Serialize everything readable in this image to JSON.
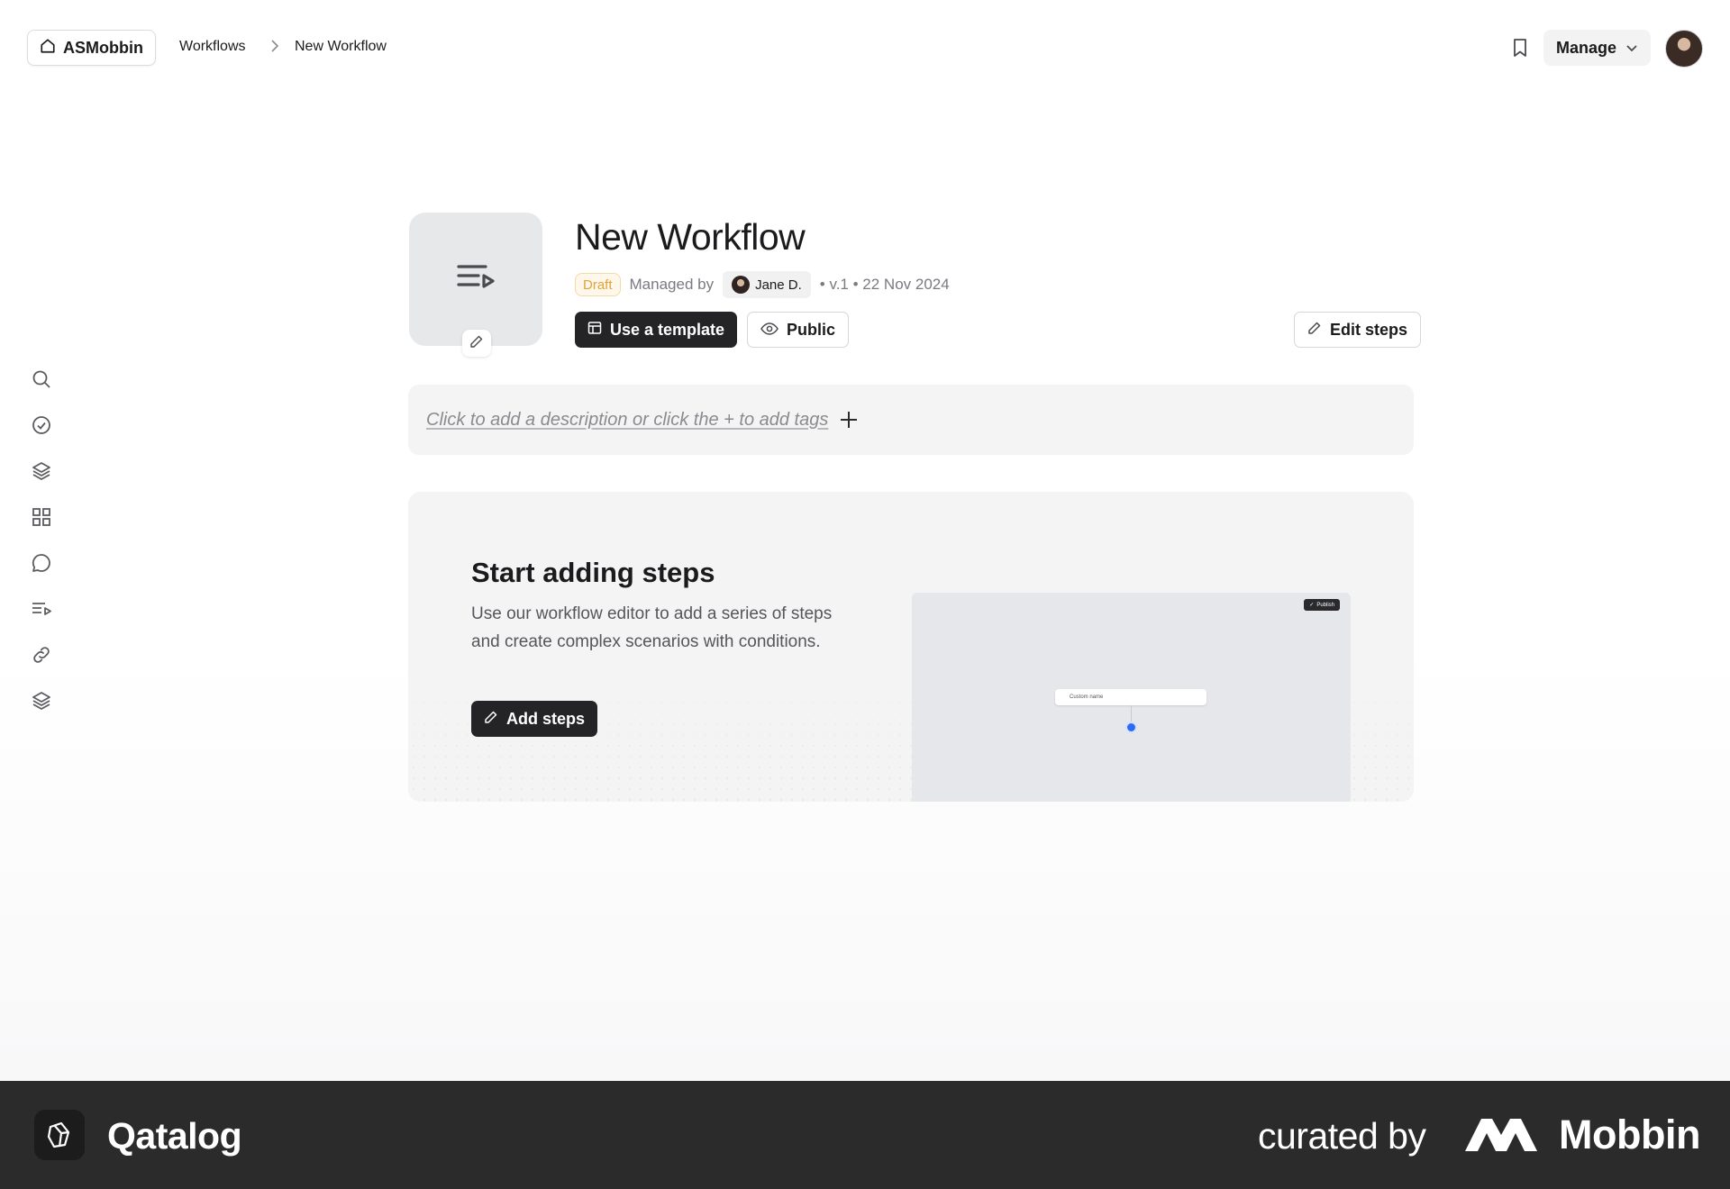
{
  "topbar": {
    "workspace_label": "ASMobbin",
    "breadcrumb": [
      "Workflows",
      "New Workflow"
    ],
    "manage_label": "Manage"
  },
  "workflow": {
    "title": "New Workflow",
    "status": "Draft",
    "managed_by_label": "Managed by",
    "owner": "Jane D.",
    "version_date": "• v.1 • 22 Nov 2024",
    "use_template_label": "Use a template",
    "visibility_label": "Public",
    "edit_steps_label": "Edit steps",
    "description_placeholder": "Click to add a description or click the + to add tags"
  },
  "empty_state": {
    "title": "Start adding steps",
    "body": "Use our workflow editor to add a series of steps and create complex scenarios with conditions.",
    "button_label": "Add steps",
    "preview_node_label": "Custom name",
    "preview_publish_label": "Publish"
  },
  "rail": {
    "icons": [
      "search-icon",
      "check-circle-icon",
      "layers-icon",
      "grid-icon",
      "chat-bubble-icon",
      "workflow-list-icon",
      "link-icon",
      "stack-icon"
    ]
  },
  "footer": {
    "brand": "Qatalog",
    "curated_label": "curated by",
    "curator": "Mobbin"
  },
  "colors": {
    "accent_dark": "#242426",
    "draft_text": "#e0a23b",
    "footer_bg": "#2b2b2c",
    "preview_dot": "#2f6bf0"
  }
}
